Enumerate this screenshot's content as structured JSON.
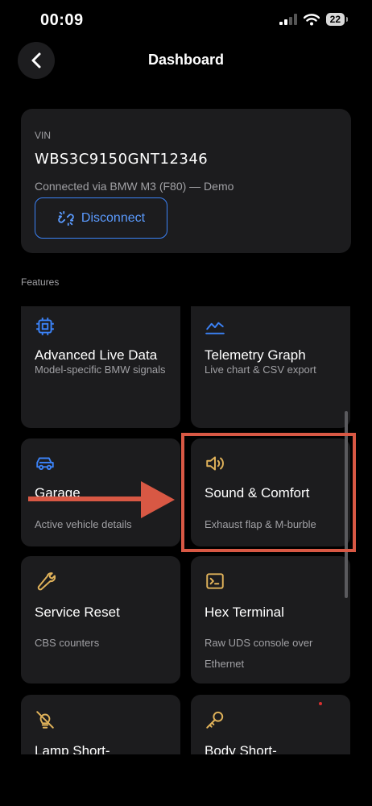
{
  "status_bar": {
    "time": "00:09",
    "battery": "22"
  },
  "nav": {
    "title": "Dashboard"
  },
  "vehicle": {
    "vin_label": "VIN",
    "vin": "WBS3C9150GNT12346",
    "connection": "Connected via BMW M3 (F80) — Demo",
    "disconnect_label": "Disconnect"
  },
  "features_label": "Features",
  "features": [
    {
      "title": "Advanced Live Data",
      "subtitle": "Model-specific BMW signals",
      "icon": "chip-icon"
    },
    {
      "title": "Telemetry Graph",
      "subtitle": "Live chart & CSV export",
      "icon": "chart-line-icon"
    },
    {
      "title": "Garage",
      "subtitle": "Active vehicle details",
      "icon": "car-icon"
    },
    {
      "title": "Sound & Comfort",
      "subtitle": "Exhaust flap & M-burble",
      "icon": "speaker-icon"
    },
    {
      "title": "Service Reset",
      "subtitle": "CBS counters",
      "icon": "wrench-icon"
    },
    {
      "title": "Hex Terminal",
      "subtitle": "Raw UDS console over Ethernet",
      "icon": "terminal-icon"
    },
    {
      "title": "Lamp Short-",
      "subtitle": "",
      "icon": "lamp-icon"
    },
    {
      "title": "Body Short-",
      "subtitle": "",
      "icon": "key-icon"
    }
  ],
  "colors": {
    "background": "#000000",
    "card": "#1c1c1e",
    "accent_blue": "#3b82f6",
    "icon_gold": "#e0b25a",
    "annotation_red": "#d85844"
  }
}
